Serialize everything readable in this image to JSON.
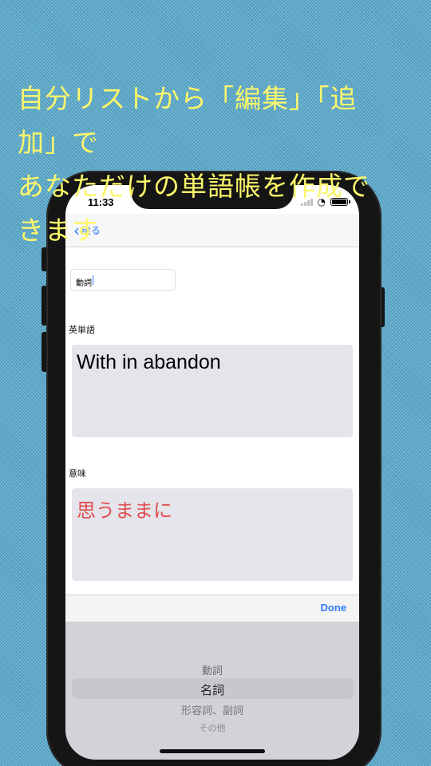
{
  "caption": {
    "lines": [
      "自分リストから「編集」「追",
      "加」で",
      "あなただけの単語帳を作成で",
      "きます"
    ],
    "color": "#fdf76a"
  },
  "status_bar": {
    "time": "11:33",
    "icons": [
      "signal-icon",
      "wifi-icon",
      "battery-icon"
    ]
  },
  "nav": {
    "back_label": "戻る"
  },
  "form": {
    "part_of_speech_value": "動詞",
    "english_label": "英単語",
    "english_value": "With in abandon",
    "meaning_label": "意味",
    "meaning_value": "思うままに",
    "meaning_color": "#e04d4d"
  },
  "picker": {
    "done_label": "Done",
    "options": [
      "動詞",
      "名詞",
      "形容詞、副詞",
      "その他"
    ],
    "selected": "名詞"
  },
  "colors": {
    "accent": "#2f7cf6",
    "background": "#5aa9c9"
  }
}
